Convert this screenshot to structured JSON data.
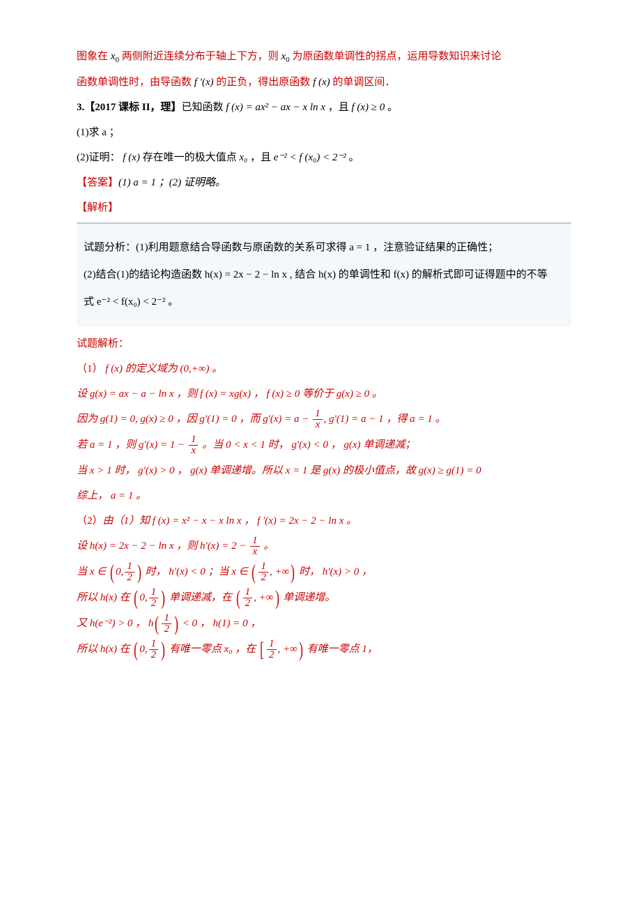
{
  "intro": {
    "line1_a": "图象在 ",
    "line1_x0": "x",
    "line1_b": " 两侧附近连续分布于轴上下方，则 ",
    "line1_c": " 为原函数单调性的拐点，运用导数知识来讨论",
    "line2_a": "函数单调性时，由导函数 ",
    "line2_fpx": "f '(x)",
    "line2_b": " 的正负，得出原函数 ",
    "line2_fx": "f (x)",
    "line2_c": " 的单调区间．"
  },
  "problem3": {
    "header_a": "3.【2017 课标 II，理】",
    "header_b": "已知函数 ",
    "func": "f (x) = ax² − ax − x ln x",
    "header_c": " ，且 ",
    "cond": "f (x) ≥ 0",
    "header_d": " 。",
    "q1": "(1)求 a ；",
    "q2_a": "(2)证明： ",
    "q2_fx": "f (x)",
    "q2_b": " 存在唯一的极大值点 ",
    "q2_x0": "x₀",
    "q2_c": " ，且 ",
    "q2_ineq": "e⁻² < f (x₀) < 2⁻²",
    "q2_d": " 。"
  },
  "answer": {
    "label": "【答案】",
    "text": "(1) a = 1 ；(2) 证明略。"
  },
  "analysis_label": "【解析】",
  "analysis_box": {
    "line1": "试题分析：(1)利用题意结合导函数与原函数的关系可求得 a = 1 ，注意验证结果的正确性；",
    "line2": "(2)结合(1)的结论构造函数 h(x) = 2x − 2 − ln x , 结合 h(x) 的单调性和 f(x) 的解析式即可证得题中的不等",
    "line3": "式 e⁻² < f(x₀) < 2⁻² 。"
  },
  "solution": {
    "header": "试题解析：",
    "p1": {
      "label": "（1）",
      "a": " f (x) 的定义域为 (0,+∞) 。"
    },
    "p1_line2": {
      "a": "设 g(x) = ax − a − ln x ，则 f (x) = xg(x) ， f (x) ≥ 0 等价于 g(x) ≥ 0 。"
    },
    "p1_line3": {
      "a": "因为 g(1) = 0, g(x) ≥ 0 ，因 g'(1) = 0 ，而 g'(x) = a − ",
      "frac_num": "1",
      "frac_den": "x",
      "b": ", g'(1) = a − 1 ，得 a = 1 。"
    },
    "p1_line4": {
      "a": "若 a = 1 ，则 g'(x) = 1 − ",
      "frac_num": "1",
      "frac_den": "x",
      "b": " 。当 0 < x < 1 时， g'(x) < 0 ， g(x) 单调递减；"
    },
    "p1_line5": {
      "a": "当 x > 1 时， g'(x) > 0 ， g(x) 单调递增。所以 x = 1 是 g(x) 的极小值点，故 g(x) ≥ g(1) = 0"
    },
    "p1_line6": "综上， a = 1 。",
    "p2": {
      "label": "（2）",
      "a": "由（1）知 f (x) = x² − x − x ln x ， f '(x) = 2x − 2 − ln x 。"
    },
    "p2_line2": {
      "a": "设 h(x) = 2x − 2 − ln x ，则 h'(x) = 2 − ",
      "frac_num": "1",
      "frac_den": "x",
      "b": " 。"
    },
    "p2_line3": {
      "a": "当 x ∈ ",
      "int1_a": "0,",
      "int1_num": "1",
      "int1_den": "2",
      "b": " 时， h'(x) < 0 ；当 x ∈ ",
      "int2_num": "1",
      "int2_den": "2",
      "int2_b": ", +∞",
      "c": " 时， h'(x) > 0 ，"
    },
    "p2_line4": {
      "a": "所以 h(x) 在 ",
      "int1_a": "0,",
      "int1_num": "1",
      "int1_den": "2",
      "b": " 单调递减，在 ",
      "int2_num": "1",
      "int2_den": "2",
      "int2_b": ", +∞",
      "c": " 单调递增。"
    },
    "p2_line5": {
      "a": "又 h(e⁻²) > 0 ， h",
      "frac_num": "1",
      "frac_den": "2",
      "b": " < 0 ， h(1) = 0 ，"
    },
    "p2_line6": {
      "a": "所以 h(x) 在 ",
      "int1_a": "0,",
      "int1_num": "1",
      "int1_den": "2",
      "b": " 有唯一零点 x₀ ，在 ",
      "int2_num": "1",
      "int2_den": "2",
      "int2_b": ", +∞",
      "c": " 有唯一零点 1，"
    }
  }
}
